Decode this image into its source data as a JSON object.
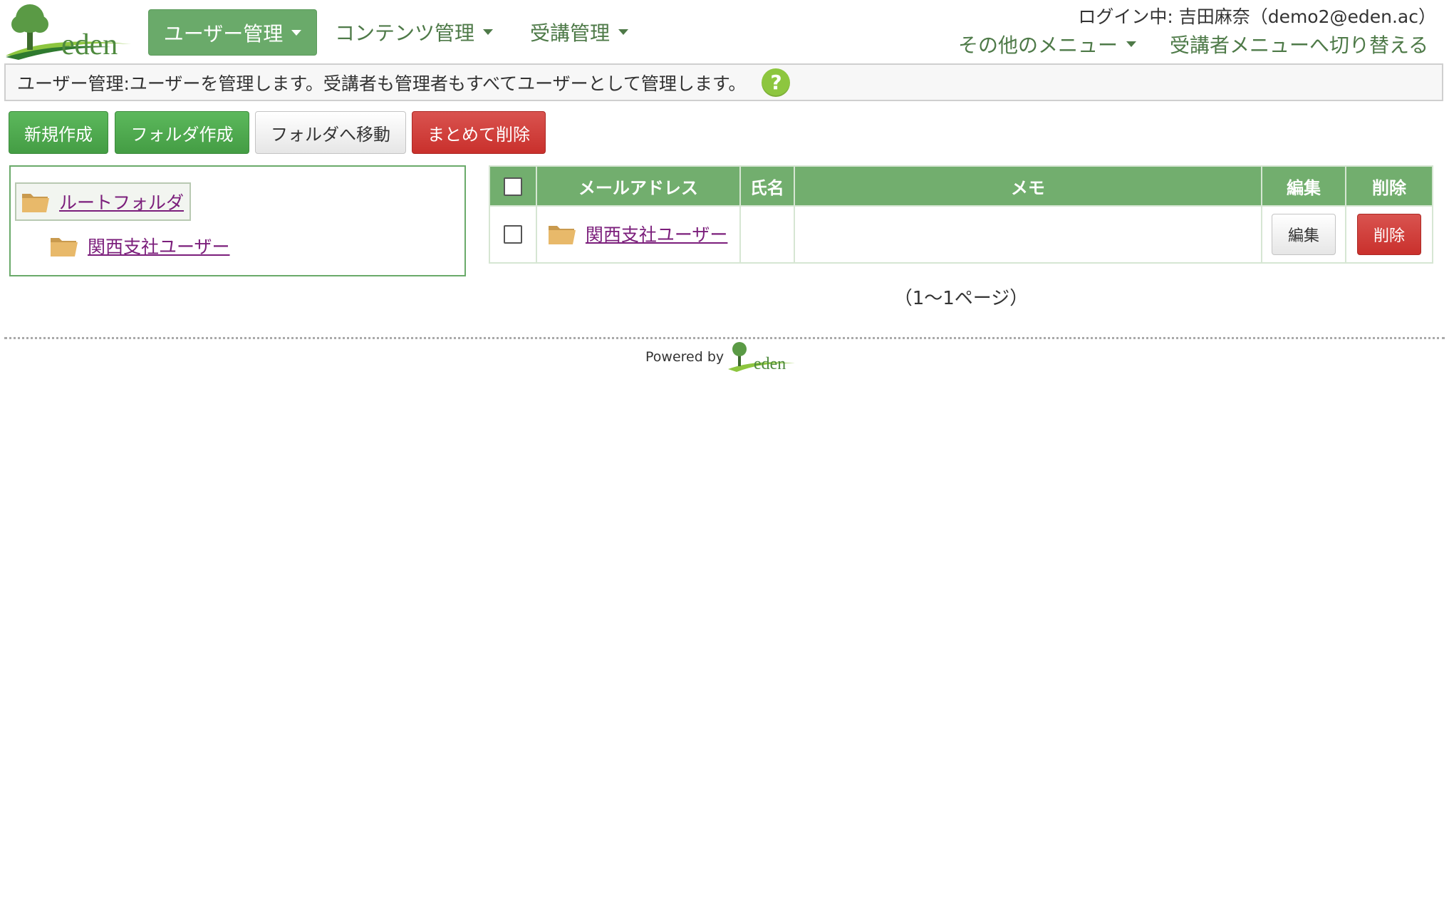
{
  "header": {
    "logo_text": "eden",
    "nav": [
      {
        "label": "ユーザー管理"
      },
      {
        "label": "コンテンツ管理"
      },
      {
        "label": "受講管理"
      }
    ],
    "login_info": "ログイン中: 吉田麻奈（demo2@eden.ac）",
    "other_menu": "その他のメニュー",
    "switch_menu": "受講者メニューへ切り替える"
  },
  "description": {
    "text": "ユーザー管理:ユーザーを管理します。受講者も管理者もすべてユーザーとして管理します。",
    "help": "?"
  },
  "toolbar": {
    "new": "新規作成",
    "new_folder": "フォルダ作成",
    "move_to_folder": "フォルダへ移動",
    "bulk_delete": "まとめて削除"
  },
  "tree": {
    "root": "ルートフォルダ",
    "children": [
      "関西支社ユーザー"
    ]
  },
  "table": {
    "columns": [
      "",
      "メールアドレス",
      "氏名",
      "メモ",
      "編集",
      "削除"
    ],
    "rows": [
      {
        "email": "関西支社ユーザー",
        "name": "",
        "memo": "",
        "edit": "編集",
        "delete": "削除"
      }
    ]
  },
  "pager": "（1〜1ページ）",
  "footer": {
    "powered_by": "Powered by",
    "logo_text": "eden"
  },
  "colors": {
    "brand_green": "#6aaa6a",
    "header_green": "#72ae6e",
    "danger_red": "#d9534f",
    "link_purple": "#7b1e7b",
    "help_green": "#8dc63f"
  }
}
